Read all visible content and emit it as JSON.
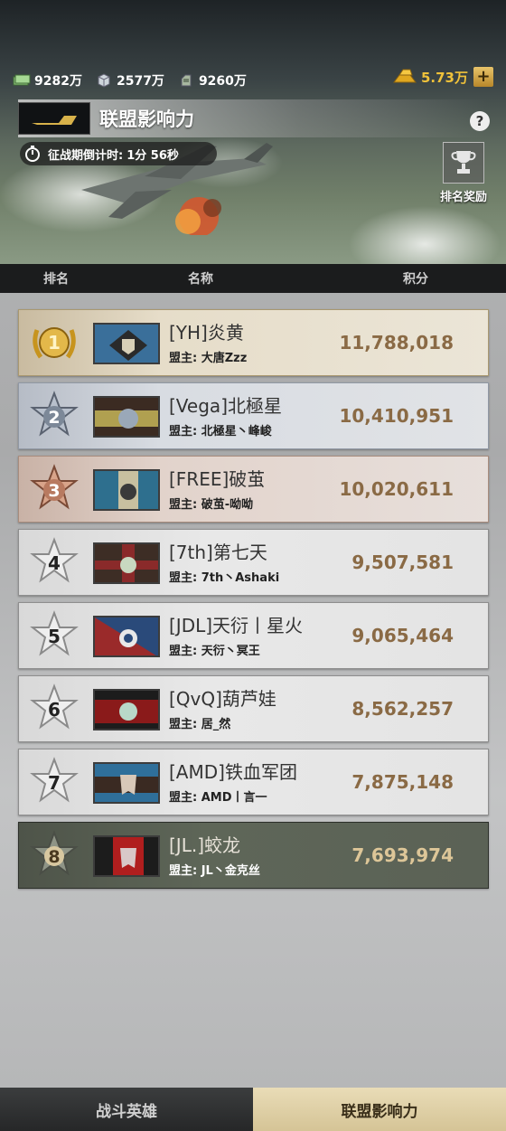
{
  "resources": [
    {
      "icon": "cash-icon",
      "value": "9282万"
    },
    {
      "icon": "supply-crate-icon",
      "value": "2577万"
    },
    {
      "icon": "fuel-icon",
      "value": "9260万"
    }
  ],
  "gold": {
    "icon": "gold-bars-icon",
    "value": "5.73万",
    "plus": "+"
  },
  "header": {
    "title": "联盟影响力",
    "help": "?",
    "countdown_label": "征战期倒计时:",
    "countdown_value": "1分 56秒",
    "reward_label": "排名奖励"
  },
  "columns": {
    "rank": "排名",
    "name": "名称",
    "score": "积分"
  },
  "rows": [
    {
      "rank": "1",
      "name": "[YH]炎黄",
      "leader": "盟主: 大唐Zzz",
      "score": "11,788,018",
      "flag_colors": [
        "#3a6f9a",
        "#2a2a2a"
      ]
    },
    {
      "rank": "2",
      "name": "[Vega]北極星",
      "leader": "盟主: 北極星丶峰峻",
      "score": "10,410,951",
      "flag_colors": [
        "#3b2b22",
        "#b0a050"
      ]
    },
    {
      "rank": "3",
      "name": "[FREE]破茧",
      "leader": "盟主: 破茧-呦呦",
      "score": "10,020,611",
      "flag_colors": [
        "#2e6f8e",
        "#c8c0a0"
      ]
    },
    {
      "rank": "4",
      "name": "[7th]第七天",
      "leader": "盟主: 7th丶Ashaki",
      "score": "9,507,581",
      "flag_colors": [
        "#3d2d25",
        "#8a2a2a"
      ]
    },
    {
      "rank": "5",
      "name": "[JDL]天衍丨星火",
      "leader": "盟主: 天衍丶冥王",
      "score": "9,065,464",
      "flag_colors": [
        "#9a2a2a",
        "#2a4a7a"
      ]
    },
    {
      "rank": "6",
      "name": "[QvQ]葫芦娃",
      "leader": "盟主: 居_然",
      "score": "8,562,257",
      "flag_colors": [
        "#8a1a1a",
        "#1c1c1c"
      ]
    },
    {
      "rank": "7",
      "name": "[AMD]铁血军团",
      "leader": "盟主: AMD丨言一",
      "score": "7,875,148",
      "flag_colors": [
        "#2f6f9a",
        "#3a2a22"
      ]
    },
    {
      "rank": "8",
      "name": "[JL.]蛟龙",
      "leader": "盟主: JL丶金克丝",
      "score": "7,693,974",
      "flag_colors": [
        "#b01e1e",
        "#1c1c1c"
      ]
    }
  ],
  "tabs": [
    {
      "label": "战斗英雄",
      "active": false
    },
    {
      "label": "联盟影响力",
      "active": true
    }
  ]
}
